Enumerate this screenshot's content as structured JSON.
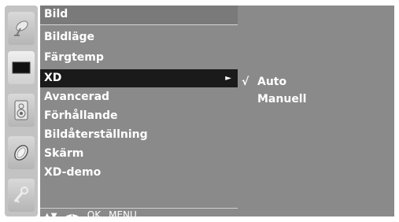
{
  "icons": [
    {
      "name": "satellite-dish-icon"
    },
    {
      "name": "picture-screen-icon"
    },
    {
      "name": "speaker-icon"
    },
    {
      "name": "clock-icon"
    },
    {
      "name": "key-lock-icon"
    }
  ],
  "menu": {
    "title": "Bild",
    "items": [
      {
        "label": "Bildläge"
      },
      {
        "label": "Färgtemp"
      },
      {
        "label": "XD",
        "arrow": "►"
      },
      {
        "label": "Avancerad"
      },
      {
        "label": "Förhållande"
      },
      {
        "label": "Bildåterställning"
      },
      {
        "label": "Skärm"
      },
      {
        "label": "XD-demo"
      }
    ],
    "selected_index": 2
  },
  "submenu": {
    "items": [
      {
        "label": "Auto",
        "check": "√"
      },
      {
        "label": "Manuell",
        "check": ""
      }
    ]
  },
  "footer": {
    "updown": "▲▼",
    "leftright": "◄►",
    "ok": "OK",
    "menu": "MENU"
  },
  "colors": {
    "panel_bg": "#8a8a8a",
    "selected_bg": "#1a1a1a",
    "text": "#ffffff",
    "icon_column": "#c3c3c3"
  }
}
